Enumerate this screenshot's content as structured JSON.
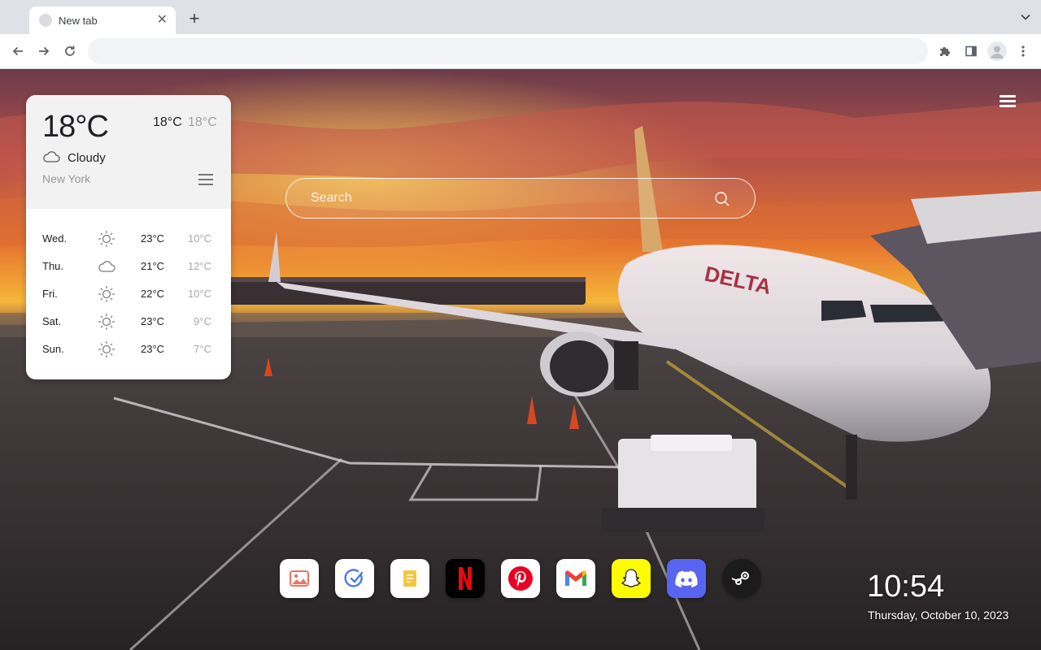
{
  "browser": {
    "tab_title": "New tab",
    "omnibox_value": ""
  },
  "icons": {
    "back": "back-arrow-icon",
    "forward": "forward-arrow-icon",
    "reload": "reload-icon",
    "extensions": "puzzle-icon",
    "side_panel": "side-panel-icon",
    "profile": "profile-avatar-icon",
    "kebab": "more-vert-icon"
  },
  "weather": {
    "temperature": "18°C",
    "high": "18°C",
    "low": "18°C",
    "condition": "Cloudy",
    "condition_icon": "cloud-icon",
    "city": "New York",
    "forecast": [
      {
        "day": "Wed.",
        "icon": "sun-icon",
        "high": "23°C",
        "low": "10°C"
      },
      {
        "day": "Thu.",
        "icon": "cloud-icon",
        "high": "21°C",
        "low": "12°C"
      },
      {
        "day": "Fri.",
        "icon": "sun-icon",
        "high": "22°C",
        "low": "10°C"
      },
      {
        "day": "Sat.",
        "icon": "sun-icon",
        "high": "23°C",
        "low": "9°C"
      },
      {
        "day": "Sun.",
        "icon": "sun-icon",
        "high": "23°C",
        "low": "7°C"
      }
    ]
  },
  "search": {
    "placeholder": "Search"
  },
  "dock": [
    {
      "name": "Photos",
      "icon": "gallery-icon",
      "color": "#ffffff"
    },
    {
      "name": "Tasks",
      "icon": "check-circle-icon",
      "color": "#ffffff"
    },
    {
      "name": "Notes",
      "icon": "notes-icon",
      "color": "#ffffff"
    },
    {
      "name": "Netflix",
      "icon": "netflix-icon",
      "color": "#000000"
    },
    {
      "name": "Pinterest",
      "icon": "pinterest-icon",
      "color": "#ffffff"
    },
    {
      "name": "Gmail",
      "icon": "gmail-icon",
      "color": "#ffffff"
    },
    {
      "name": "Snapchat",
      "icon": "snapchat-icon",
      "color": "#fffc00"
    },
    {
      "name": "Discord",
      "icon": "discord-icon",
      "color": "#5865f2"
    },
    {
      "name": "Steam",
      "icon": "steam-icon",
      "color": "#1b1b1b"
    }
  ],
  "clock": {
    "time": "10:54",
    "date": "Thursday, October 10, 2023"
  }
}
